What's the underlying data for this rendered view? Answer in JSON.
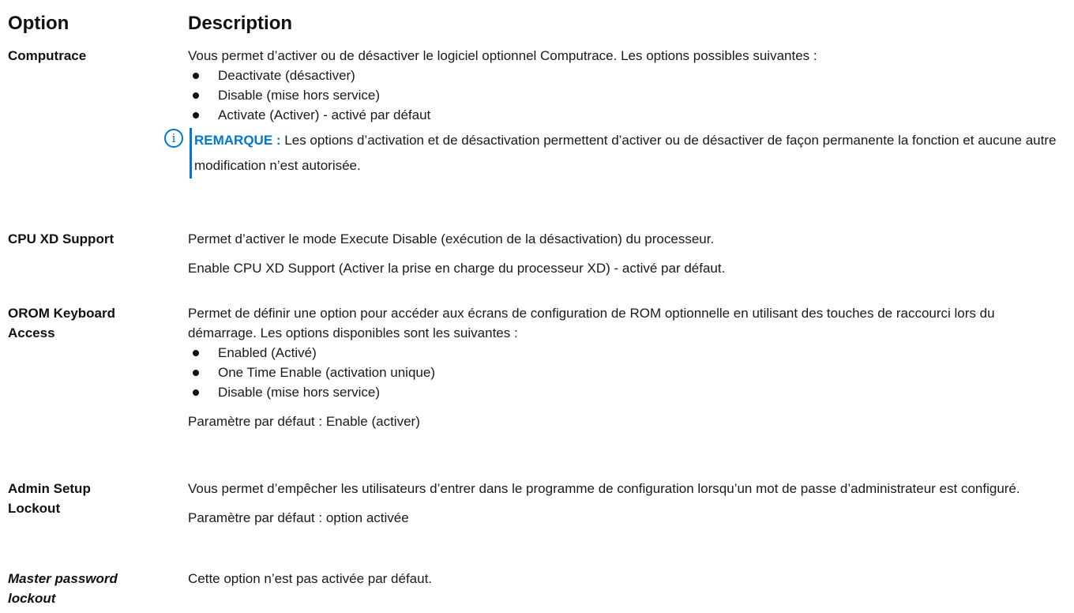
{
  "header": {
    "option": "Option",
    "description": "Description"
  },
  "rows": [
    {
      "option": "Computrace",
      "intro": "Vous permet d’activer ou de désactiver le logiciel optionnel Computrace. Les options possibles suivantes :",
      "bullets": [
        "Deactivate (désactiver)",
        "Disable (mise hors service)",
        "Activate (Activer) - activé par défaut"
      ],
      "note": {
        "icon": "info-icon",
        "label": "REMARQUE :",
        "text": " Les options d’activation et de désactivation permettent d’activer ou de désactiver de façon permanente la fonction et aucune autre modification n’est autorisée."
      }
    },
    {
      "option": "CPU XD Support",
      "line1": "Permet d’activer le mode Execute Disable (exécution de la désactivation) du processeur.",
      "line2": "Enable CPU XD Support (Activer la prise en charge du processeur XD) - activé par défaut."
    },
    {
      "option_line1": "OROM Keyboard",
      "option_line2": "Access",
      "intro": "Permet de définir une option pour accéder aux écrans de configuration de ROM optionnelle en utilisant des touches de raccourci lors du démarrage. Les options disponibles sont les suivantes :",
      "bullets": [
        "Enabled (Activé)",
        "One Time Enable (activation unique)",
        "Disable (mise hors service)"
      ],
      "default": "Paramètre par défaut : Enable (activer)"
    },
    {
      "option_line1": "Admin Setup",
      "option_line2": "Lockout",
      "intro": "Vous permet d’empêcher les utilisateurs d’entrer dans le programme de configuration lorsqu’un mot de passe d’administrateur est configuré.",
      "default": "Paramètre par défaut : option activée"
    },
    {
      "option_line1": "Master password",
      "option_line2": "lockout",
      "line1": "Cette option n’est pas activée par défaut."
    }
  ]
}
